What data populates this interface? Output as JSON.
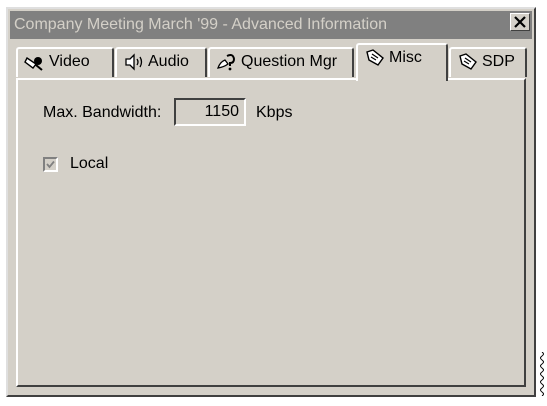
{
  "window": {
    "title": "Company Meeting March '99 - Advanced Information",
    "close_label": "✕"
  },
  "tabs": [
    {
      "label": "Video",
      "icon": "video-camera-icon",
      "active": false
    },
    {
      "label": "Audio",
      "icon": "speaker-icon",
      "active": false
    },
    {
      "label": "Question Mgr",
      "icon": "question-manager-icon",
      "active": false
    },
    {
      "label": "Misc",
      "icon": "misc-hand-icon",
      "active": true
    },
    {
      "label": "SDP",
      "icon": "sdp-hand-icon",
      "active": false
    }
  ],
  "misc": {
    "bandwidth_label": "Max. Bandwidth:",
    "bandwidth_value": "1150",
    "bandwidth_unit": "Kbps",
    "local_label": "Local",
    "local_checked": true,
    "local_disabled": true
  },
  "colors": {
    "dialog_bg": "#d4d0c8",
    "titlebar_inactive": "#808080",
    "titlebar_text": "#d4d0c8"
  }
}
